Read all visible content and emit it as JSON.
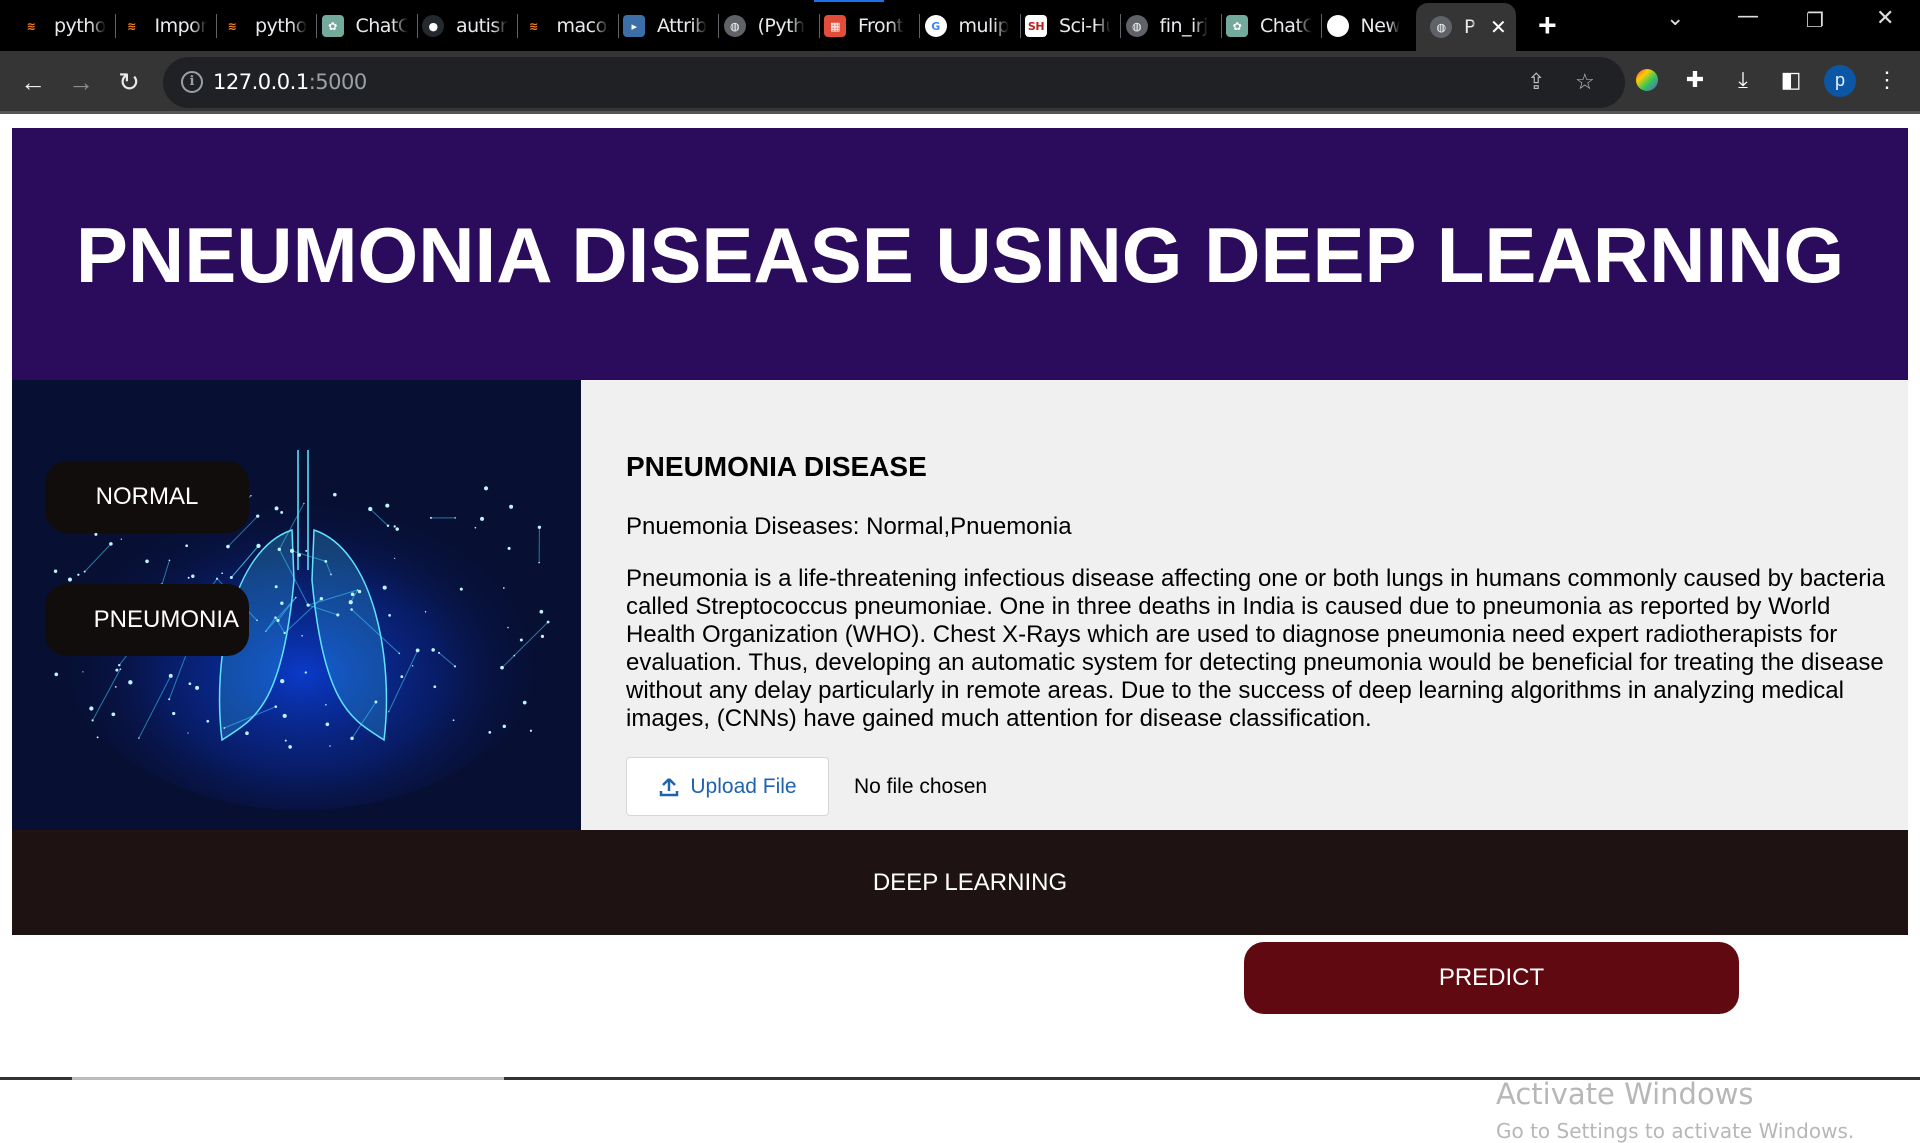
{
  "browser": {
    "tabs": [
      {
        "title": "python",
        "icon": "stackoverflow-icon"
      },
      {
        "title": "Import",
        "icon": "stackoverflow-icon"
      },
      {
        "title": "python",
        "icon": "stackoverflow-icon"
      },
      {
        "title": "ChatGPT",
        "icon": "chatgpt-icon"
      },
      {
        "title": "autism",
        "icon": "github-icon"
      },
      {
        "title": "macos",
        "icon": "stackoverflow-icon"
      },
      {
        "title": "Attrib",
        "icon": "terminal-icon"
      },
      {
        "title": "(Pyth",
        "icon": "globe-icon"
      },
      {
        "title": "Front",
        "icon": "colorful-blocks-icon"
      },
      {
        "title": "mulip",
        "icon": "google-icon"
      },
      {
        "title": "Sci-Hub",
        "icon": "scihub-icon"
      },
      {
        "title": "fin_irj",
        "icon": "globe-icon"
      },
      {
        "title": "ChatGPT",
        "icon": "chatgpt-icon"
      },
      {
        "title": "New",
        "icon": "chrome-icon"
      },
      {
        "title": "P",
        "icon": "globe-icon",
        "active": true
      }
    ],
    "new_tab_label": "+",
    "url_host": "127.0.0.1",
    "url_port": ":5000",
    "profile_initial": "p"
  },
  "header": {
    "title": "PNEUMONIA DISEASE USING DEEP LEARNING"
  },
  "left_panel": {
    "image_alt": "glowing blue network lungs",
    "buttons": [
      {
        "label": "NORMAL"
      },
      {
        "label": "PNEUMONIA"
      }
    ]
  },
  "main": {
    "heading": "PNEUMONIA DISEASE",
    "subline": "Pnuemonia Diseases: Normal,Pnuemonia",
    "description": "Pneumonia is a life-threatening infectious disease affecting one or both lungs in humans commonly caused by bacteria called Streptococcus pneumoniae. One in three deaths in India is caused due to pneumonia as reported by World Health Organization (WHO). Chest X-Rays which are used to diagnose pneumonia need expert radiotherapists for evaluation. Thus, developing an automatic system for detecting pneumonia would be beneficial for treating the disease without any delay particularly in remote areas. Due to the success of deep learning algorithms in analyzing medical images, (CNNs) have gained much attention for disease classification.",
    "upload_label": "Upload File",
    "file_status": "No file chosen"
  },
  "footer": {
    "label": "DEEP LEARNING"
  },
  "predict": {
    "label": "PREDICT"
  },
  "watermark": {
    "line1": "Activate Windows",
    "line2": "Go to Settings to activate Windows."
  },
  "colors": {
    "banner": "#2b0b5c",
    "left_panel": "#070f33",
    "main_panel": "#f0f0f0",
    "footer": "#1f1212",
    "predict": "#600910",
    "class_button": "#110d0d",
    "upload_text": "#1f62b0"
  }
}
